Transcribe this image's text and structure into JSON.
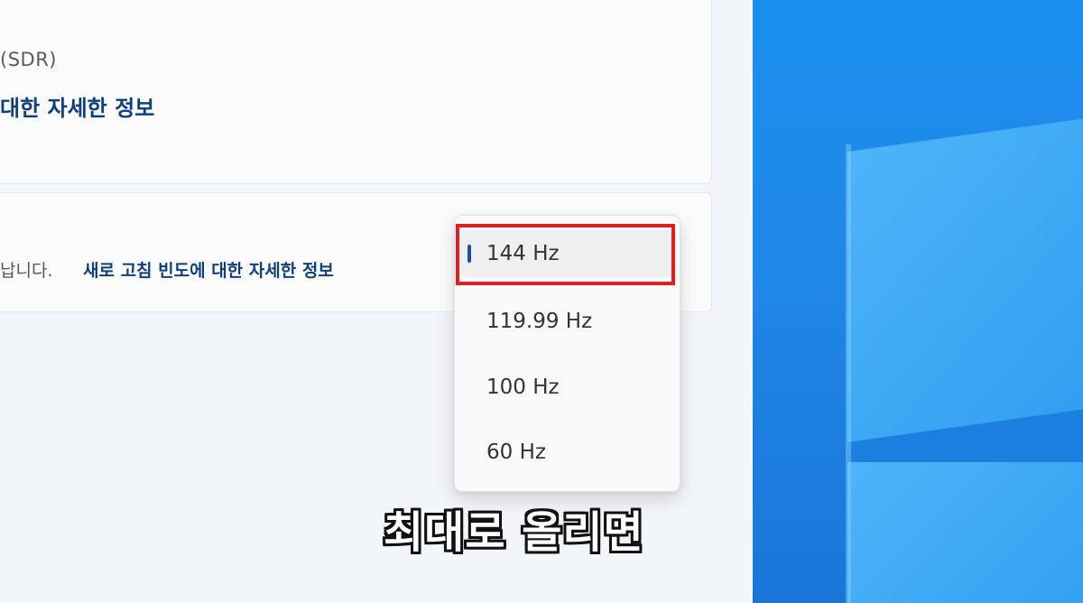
{
  "display_card": {
    "caption": "(SDR)",
    "link": "대한 자세한 정보"
  },
  "refresh_card": {
    "description": "납니다.",
    "link": "새로 고침 빈도에 대한 자세한 정보"
  },
  "dropdown": {
    "options": [
      "144 Hz",
      "119.99 Hz",
      "100 Hz",
      "60 Hz"
    ],
    "selected": "144 Hz"
  },
  "overlay_caption": "최대로 올리면",
  "colors": {
    "accent": "#1f4f9b",
    "highlight": "#e02020",
    "link": "#0f3f7f"
  }
}
